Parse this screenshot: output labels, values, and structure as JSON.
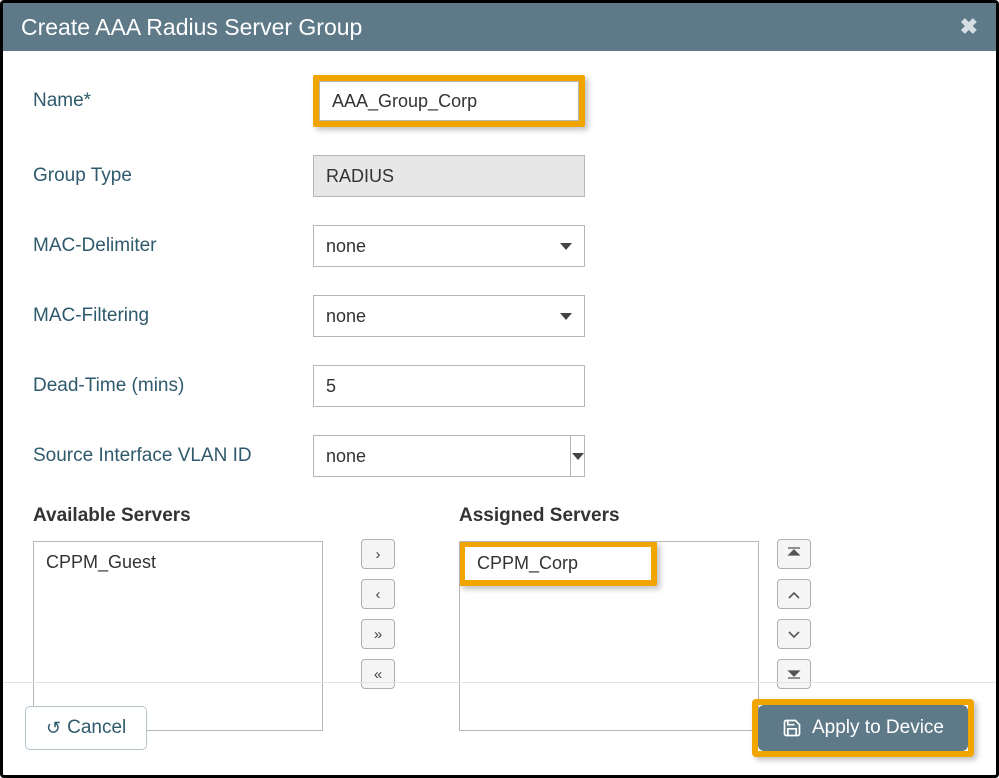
{
  "header": {
    "title": "Create AAA Radius Server Group"
  },
  "form": {
    "name_label": "Name*",
    "name_value": "AAA_Group_Corp",
    "group_type_label": "Group Type",
    "group_type_value": "RADIUS",
    "mac_delimiter_label": "MAC-Delimiter",
    "mac_delimiter_value": "none",
    "mac_filtering_label": "MAC-Filtering",
    "mac_filtering_value": "none",
    "dead_time_label": "Dead-Time (mins)",
    "dead_time_value": "5",
    "source_vlan_label": "Source Interface VLAN ID",
    "source_vlan_value": "none"
  },
  "servers": {
    "available_label": "Available Servers",
    "assigned_label": "Assigned Servers",
    "available": [
      "CPPM_Guest"
    ],
    "assigned": [
      "CPPM_Corp"
    ]
  },
  "footer": {
    "cancel_label": "Cancel",
    "apply_label": "Apply to Device"
  }
}
